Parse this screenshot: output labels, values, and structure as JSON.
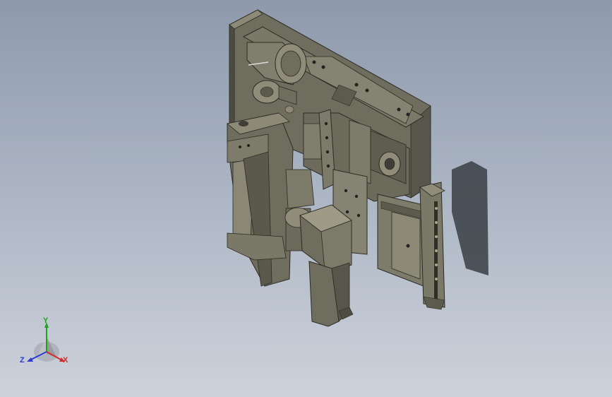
{
  "viewport": {
    "background_top": "#8e99ab",
    "background_bottom": "#cdd2db",
    "model_color": "#6e6d5e",
    "model_shade": "#4d4c41",
    "model_light": "#8c8a77"
  },
  "triad": {
    "x_label": "X",
    "y_label": "Y",
    "z_label": "Z",
    "x_color": "#d62a2a",
    "y_color": "#1fa31f",
    "z_color": "#2a3bd6"
  }
}
